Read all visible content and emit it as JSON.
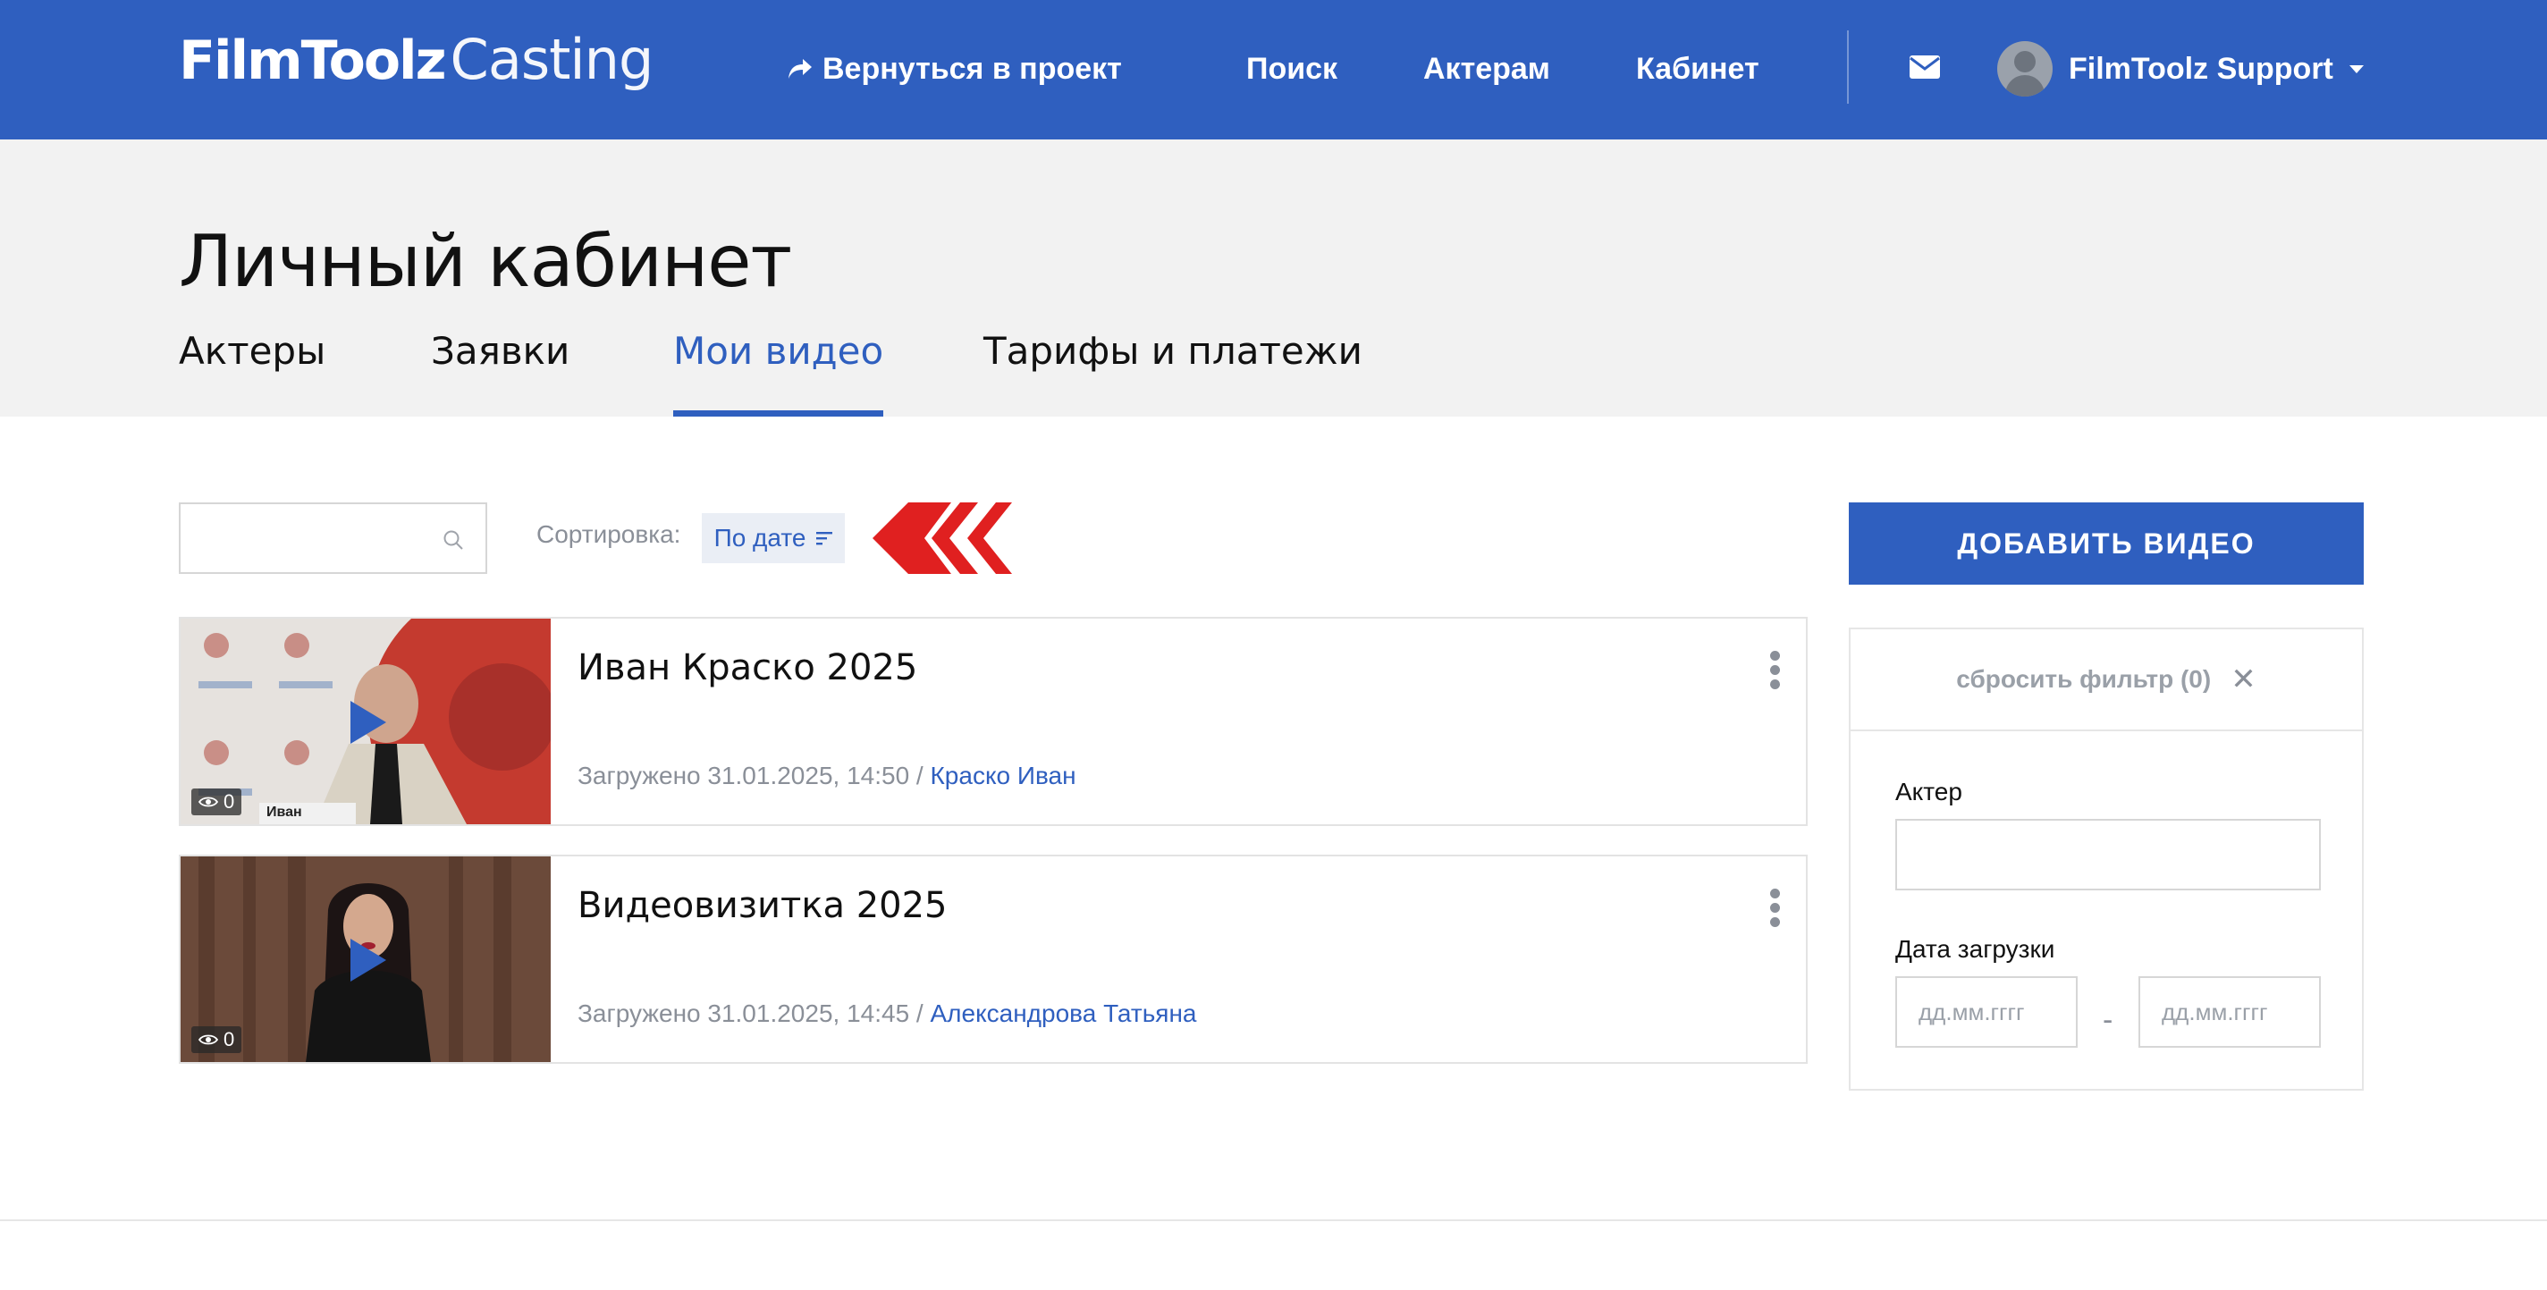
{
  "header": {
    "logo_bold": "FilmToolz",
    "logo_light": "Casting",
    "back_link": "Вернуться в проект",
    "nav": [
      "Поиск",
      "Актерам",
      "Кабинет"
    ],
    "user_name": "FilmToolz Support"
  },
  "hero": {
    "title": "Личный кабинет",
    "tabs": [
      "Актеры",
      "Заявки",
      "Мои видео",
      "Тарифы и платежи"
    ],
    "active_tab": "Мои видео"
  },
  "toolbar": {
    "search_value": "",
    "sort_label": "Сортировка:",
    "sort_value": "По дате"
  },
  "videos": [
    {
      "title": "Иван Краско 2025",
      "uploaded": "Загружено 31.01.2025, 14:50 / ",
      "actor": "Краско Иван",
      "views": "0",
      "thumb_caption": "Иван"
    },
    {
      "title": "Видеовизитка 2025",
      "uploaded": "Загружено 31.01.2025, 14:45 / ",
      "actor": "Александрова Татьяна",
      "views": "0"
    }
  ],
  "sidebar": {
    "add_button": "ДОБАВИТЬ ВИДЕО",
    "reset_filter": "сбросить фильтр (0)",
    "actor_label": "Актер",
    "actor_value": "",
    "date_label": "Дата загрузки",
    "date_from_placeholder": "дд.мм.гггг",
    "date_to_placeholder": "дд.мм.гггг",
    "date_separator": "-"
  },
  "colors": {
    "brand_blue": "#2f5fbf",
    "hero_bg": "#f2f2f2",
    "accent_red": "#e02020"
  }
}
